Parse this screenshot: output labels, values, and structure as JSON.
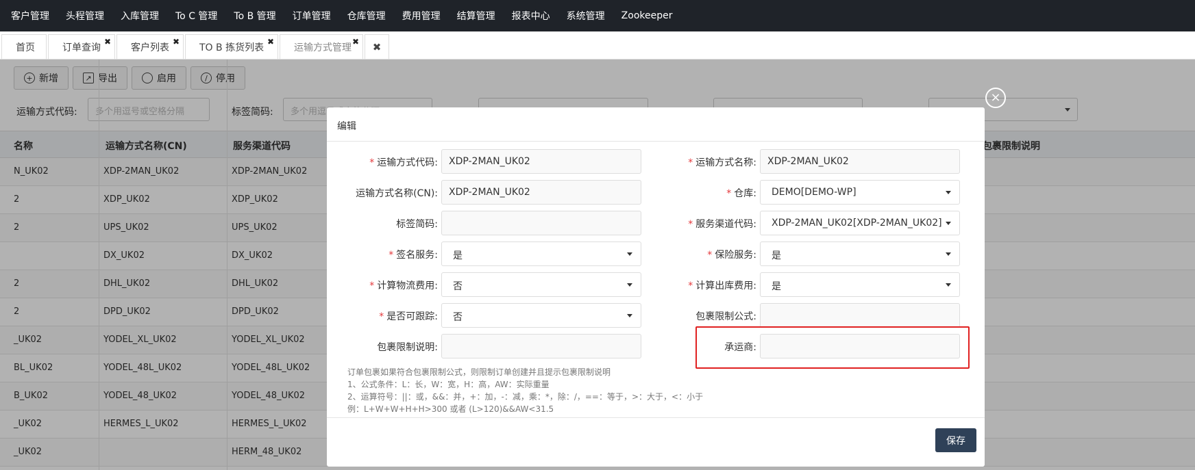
{
  "nav": [
    "客户管理",
    "头程管理",
    "入库管理",
    "To C 管理",
    "To B 管理",
    "订单管理",
    "仓库管理",
    "费用管理",
    "结算管理",
    "报表中心",
    "系统管理",
    "Zookeeper"
  ],
  "tabs": [
    {
      "label": "首页",
      "closable": false
    },
    {
      "label": "订单查询",
      "closable": true
    },
    {
      "label": "客户列表",
      "closable": true
    },
    {
      "label": "TO B 拣货列表",
      "closable": true
    },
    {
      "label": "运输方式管理",
      "closable": true
    }
  ],
  "tab_close_glyph": "✖",
  "toolbar": {
    "add": "新增",
    "export": "导出",
    "enable": "启用",
    "disable": "停用"
  },
  "filters": {
    "code_label": "运输方式代码:",
    "code_placeholder": "多个用逗号或空格分隔",
    "tag_label": "标签简码:",
    "tag_placeholder": "多个用逗号或空格分隔"
  },
  "grid": {
    "headers": [
      "名称",
      "运输方式名称(CN)",
      "服务渠道代码",
      "包裹限制说明"
    ],
    "rows": [
      [
        "N_UK02",
        "XDP-2MAN_UK02",
        "XDP-2MAN_UK02"
      ],
      [
        "2",
        "XDP_UK02",
        "XDP_UK02"
      ],
      [
        "2",
        "UPS_UK02",
        "UPS_UK02"
      ],
      [
        "",
        "DX_UK02",
        "DX_UK02"
      ],
      [
        "2",
        "DHL_UK02",
        "DHL_UK02"
      ],
      [
        "2",
        "DPD_UK02",
        "DPD_UK02"
      ],
      [
        "_UK02",
        "YODEL_XL_UK02",
        "YODEL_XL_UK02"
      ],
      [
        "BL_UK02",
        "YODEL_48L_UK02",
        "YODEL_48L_UK02"
      ],
      [
        "B_UK02",
        "YODEL_48_UK02",
        "YODEL_48_UK02"
      ],
      [
        "_UK02",
        "HERMES_L_UK02",
        "HERMES_L_UK02"
      ],
      [
        "_UK02",
        "",
        "HERM_48_UK02"
      ]
    ]
  },
  "modal": {
    "title": "编辑",
    "close_glyph": "×",
    "required_mark": "*",
    "fields": {
      "code": {
        "label": "运输方式代码:",
        "value": "XDP-2MAN_UK02",
        "required": true
      },
      "name": {
        "label": "运输方式名称:",
        "value": "XDP-2MAN_UK02",
        "required": true
      },
      "name_cn": {
        "label": "运输方式名称(CN):",
        "value": "XDP-2MAN_UK02",
        "required": false
      },
      "warehouse": {
        "label": "仓库:",
        "value": "DEMO[DEMO-WP]",
        "required": true
      },
      "tag_code": {
        "label": "标签简码:",
        "value": "",
        "required": false
      },
      "channel": {
        "label": "服务渠道代码:",
        "value": "XDP-2MAN_UK02[XDP-2MAN_UK02]",
        "required": true
      },
      "signature": {
        "label": "签名服务:",
        "value": "是",
        "required": true
      },
      "insurance": {
        "label": "保险服务:",
        "value": "是",
        "required": true
      },
      "logistics_fee": {
        "label": "计算物流费用:",
        "value": "否",
        "required": true
      },
      "outbound_fee": {
        "label": "计算出库费用:",
        "value": "是",
        "required": true
      },
      "trackable": {
        "label": "是否可跟踪:",
        "value": "否",
        "required": true
      },
      "package_formula": {
        "label": "包裹限制公式:",
        "value": "",
        "required": false
      },
      "package_desc": {
        "label": "包裹限制说明:",
        "value": "",
        "required": false
      },
      "carrier": {
        "label": "承运商:",
        "value": "",
        "required": false
      }
    },
    "hint": [
      "订单包裹如果符合包裹限制公式，则限制订单创建并且提示包裹限制说明",
      "1、公式条件：L：长，W：宽，H：高，AW：实际重量",
      "2、运算符号：||：或，&&：并，+：加，-：减，乘：*，除：/，==：等于，>：大于，<：小于",
      "例：L+W+W+H+H>300 或者 (L>120)&&AW<31.5"
    ],
    "save": "保存"
  },
  "colors": {
    "topnav": "#1f2329",
    "primary_button": "#2f4158",
    "highlight": "#e02020",
    "required": "#e4393c"
  }
}
